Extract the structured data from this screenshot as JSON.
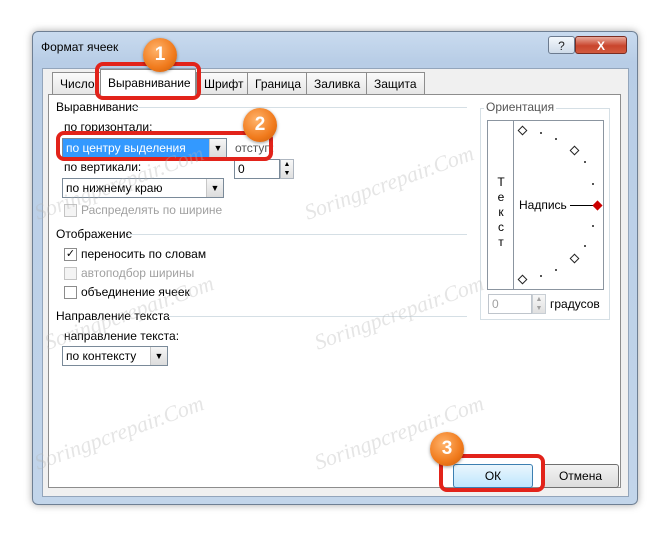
{
  "window": {
    "title": "Формат ячеек",
    "help": "?",
    "close": "X"
  },
  "tabs": [
    "Число",
    "Выравнивание",
    "Шрифт",
    "Граница",
    "Заливка",
    "Защита"
  ],
  "alignment": {
    "group": "Выравнивание",
    "horizontal_label": "по горизонтали:",
    "horizontal_value": "по центру выделения",
    "indent_label": "отступ:",
    "indent_value": "0",
    "vertical_label": "по вертикали:",
    "vertical_value": "по нижнему краю",
    "distribute_label": "Распределять по ширине"
  },
  "display": {
    "group": "Отображение",
    "wrap_label": "переносить по словам",
    "wrap_checked": true,
    "autofit_label": "автоподбор ширины",
    "merge_label": "объединение ячеек"
  },
  "direction": {
    "group": "Направление текста",
    "label": "направление текста:",
    "value": "по контексту"
  },
  "orientation": {
    "group": "Ориентация",
    "vertical_text": [
      "Т",
      "е",
      "к",
      "с",
      "т"
    ],
    "caption": "Надпись",
    "degrees_value": "0",
    "degrees_label": "градусов"
  },
  "buttons": {
    "ok": "ОК",
    "cancel": "Отмена"
  },
  "annotations": {
    "badge1": "1",
    "badge2": "2",
    "badge3": "3",
    "accent_color": "#e2231a",
    "badge_color": "#f07a1c"
  },
  "watermark": "Soringpcrepair.Com"
}
